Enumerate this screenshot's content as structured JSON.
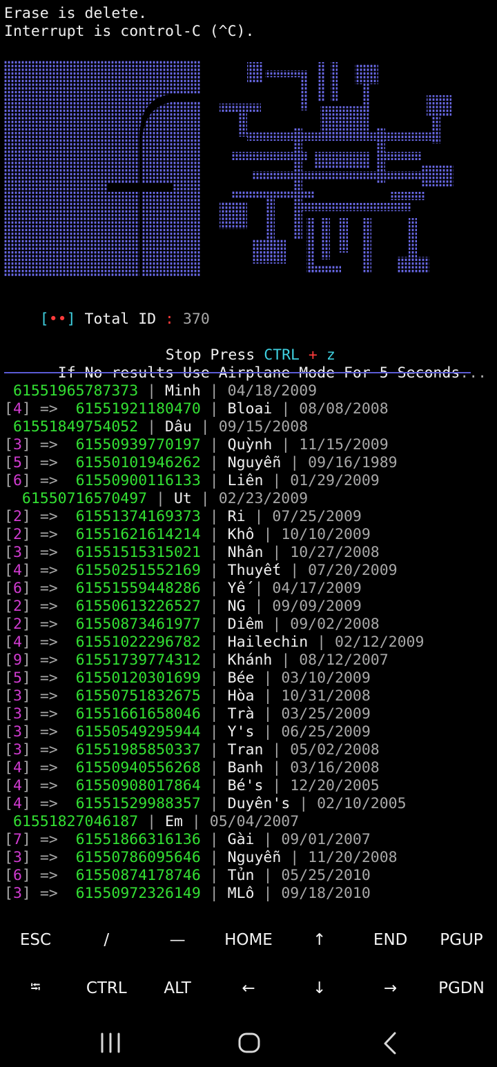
{
  "terminal": {
    "header_lines": [
      "Erase is delete.",
      "Interrupt is control-C (^C)."
    ],
    "total": {
      "open": "[",
      "dots": "••",
      "close": "]",
      "label": "Total ID",
      "sep": ":",
      "value": "370"
    },
    "stop": {
      "prefix": "Stop Press",
      "key1": "CTRL",
      "plus": "+",
      "key2": "z"
    },
    "airplane_text": "If No results Use Airplane Mode For 5 Seconds",
    "airplane_dots": "...",
    "arrow": "=>",
    "results": [
      {
        "num": "",
        "id": "61551965787373",
        "name": "Minh",
        "date": "04/18/2009",
        "indent": 1
      },
      {
        "num": "4",
        "id": "61551921180470",
        "name": "Bloai",
        "date": "08/08/2008"
      },
      {
        "num": "",
        "id": "61551849754052",
        "name": "Dâu",
        "date": "09/15/2008",
        "indent": 1
      },
      {
        "num": "3",
        "id": "61550939770197",
        "name": "Quỳnh",
        "date": "11/15/2009"
      },
      {
        "num": "5",
        "id": "61550101946262",
        "name": "Nguyễn",
        "date": "09/16/1989"
      },
      {
        "num": "6",
        "id": "61550900116133",
        "name": "Liên",
        "date": "01/29/2009"
      },
      {
        "num": "",
        "id": "61550716570497",
        "name": "Ut",
        "date": "02/23/2009",
        "indent": 2
      },
      {
        "num": "2",
        "id": "61551374169373",
        "name": "Ri",
        "date": "07/25/2009"
      },
      {
        "num": "2",
        "id": "61551621614214",
        "name": "Khô",
        "date": "10/10/2009"
      },
      {
        "num": "3",
        "id": "61551515315021",
        "name": "Nhân",
        "date": "10/27/2008"
      },
      {
        "num": "4",
        "id": "61550251552169",
        "name": "Thuyết",
        "date": "07/20/2009"
      },
      {
        "num": "6",
        "id": "61551559448286",
        "name": "Yế",
        "date": "04/17/2009"
      },
      {
        "num": "2",
        "id": "61550613226527",
        "name": "NG",
        "date": "09/09/2009"
      },
      {
        "num": "2",
        "id": "61550873461977",
        "name": "Diêm",
        "date": "09/02/2008"
      },
      {
        "num": "4",
        "id": "61551022296782",
        "name": "Hailechin",
        "date": "02/12/2009"
      },
      {
        "num": "9",
        "id": "61551739774312",
        "name": "Khánh",
        "date": "08/12/2007"
      },
      {
        "num": "5",
        "id": "61550120301699",
        "name": "Bée",
        "date": "03/10/2009"
      },
      {
        "num": "3",
        "id": "61550751832675",
        "name": "Hòa",
        "date": "10/31/2008"
      },
      {
        "num": "3",
        "id": "61551661658046",
        "name": "Trà",
        "date": "03/25/2009"
      },
      {
        "num": "3",
        "id": "61550549295944",
        "name": "Y's",
        "date": "06/25/2009"
      },
      {
        "num": "3",
        "id": "61551985850337",
        "name": "Tran",
        "date": "05/02/2008"
      },
      {
        "num": "4",
        "id": "61550940556268",
        "name": "Banh",
        "date": "03/16/2008"
      },
      {
        "num": "4",
        "id": "61550908017864",
        "name": "Bé's",
        "date": "12/20/2005"
      },
      {
        "num": "4",
        "id": "61551529988357",
        "name": "Duyên's",
        "date": "02/10/2005"
      },
      {
        "num": "",
        "id": "61551827046187",
        "name": "Em",
        "date": "05/04/2007",
        "indent": 1
      },
      {
        "num": "7",
        "id": "61551866316136",
        "name": "Gài",
        "date": "09/01/2007"
      },
      {
        "num": "3",
        "id": "61550786095646",
        "name": "Nguyễn",
        "date": "11/20/2008"
      },
      {
        "num": "6",
        "id": "61550874178746",
        "name": "Tủn",
        "date": "05/25/2010"
      },
      {
        "num": "3",
        "id": "61550972326149",
        "name": "MLô",
        "date": "09/18/2010"
      }
    ]
  },
  "extra_keys": {
    "row1": [
      "ESC",
      "/",
      "—",
      "HOME",
      "↑",
      "END",
      "PGUP"
    ],
    "row2": [
      "⭾",
      "CTRL",
      "ALT",
      "←",
      "↓",
      "→",
      "PGDN"
    ]
  },
  "colors": {
    "green": "#33e033",
    "purple": "#d13bd1",
    "cyan": "#3fd0e0",
    "red": "#ff3b3b",
    "banner_blue": "#6a6ae8",
    "rule_blue": "#5b5bd6"
  },
  "icons": [
    "recent-apps-icon",
    "home-icon",
    "back-icon"
  ]
}
